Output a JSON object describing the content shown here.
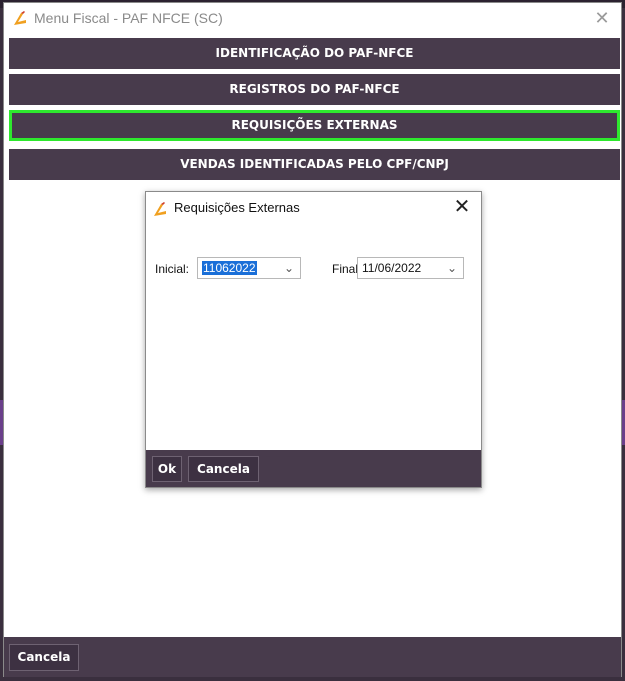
{
  "window": {
    "title": "Menu Fiscal - PAF NFCE (SC)",
    "close_glyph": "✕"
  },
  "menu": {
    "items": [
      {
        "label": "IDENTIFICAÇÃO DO PAF-NFCE"
      },
      {
        "label": "REGISTROS DO PAF-NFCE"
      },
      {
        "label": "REQUISIÇÕES EXTERNAS",
        "focused": true
      },
      {
        "label": "VENDAS IDENTIFICADAS PELO CPF/CNPJ"
      }
    ]
  },
  "footer": {
    "cancel_label": "Cancela"
  },
  "dialog": {
    "title": "Requisições Externas",
    "close_glyph": "✕",
    "initial_label": "Inicial:",
    "initial_value": "11062022",
    "final_label": "Final:",
    "final_value": "11/06/2022",
    "arrow_glyph": "⌄",
    "ok_label": "Ok",
    "cancel_label": "Cancela"
  },
  "colors": {
    "button_bg": "#483b4c",
    "focus_border": "#2ee82e",
    "selection": "#1a6fd8",
    "icon_accent": "#f0a020"
  },
  "icons": {
    "app": "lightning-logo-icon",
    "close": "close-icon",
    "dropdown": "chevron-down-icon"
  }
}
